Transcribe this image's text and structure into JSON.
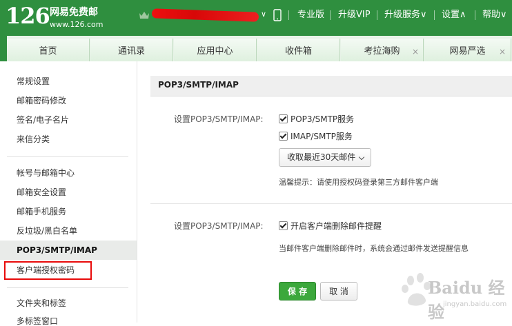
{
  "header": {
    "logo_num": "126",
    "logo_text": "网易免费邮",
    "logo_url": "www.126.com",
    "user_caret": "∨",
    "links": [
      "专业版",
      "升级VIP",
      "升级服务∨",
      "设置∧",
      "帮助∨"
    ]
  },
  "tabs": [
    {
      "label": "首页"
    },
    {
      "label": "通讯录"
    },
    {
      "label": "应用中心"
    },
    {
      "label": "收件箱"
    },
    {
      "label": "考拉海购",
      "close": "×"
    },
    {
      "label": "网易严选",
      "close": "×"
    }
  ],
  "sidebar": {
    "items": [
      "常规设置",
      "邮箱密码修改",
      "签名/电子名片",
      "来信分类",
      "帐号与邮箱中心",
      "邮箱安全设置",
      "邮箱手机服务",
      "反垃圾/黑白名单",
      "POP3/SMTP/IMAP",
      "客户端授权密码",
      "文件夹和标签",
      "多标签窗口"
    ],
    "active_index": 8
  },
  "content": {
    "title": "POP3/SMTP/IMAP",
    "section1_label": "设置POP3/SMTP/IMAP:",
    "option_pop3": "POP3/SMTP服务",
    "option_imap": "IMAP/SMTP服务",
    "select_value": "收取最近30天邮件",
    "tip": "温馨提示：请使用授权码登录第三方邮件客户端",
    "section2_label": "设置POP3/SMTP/IMAP:",
    "option_delete_alert": "开启客户端删除邮件提醒",
    "delete_note": "当邮件客户端删除邮件时，系统会通过邮件发送提醒信息",
    "save": "保 存",
    "cancel": "取 消"
  },
  "watermark": {
    "text": "Baidu 经验",
    "url": "jingyan.baidu.com"
  },
  "colors": {
    "header_green": "#2f8f3f",
    "save_green": "#3ca83c",
    "highlight_red": "#e80a0a"
  }
}
